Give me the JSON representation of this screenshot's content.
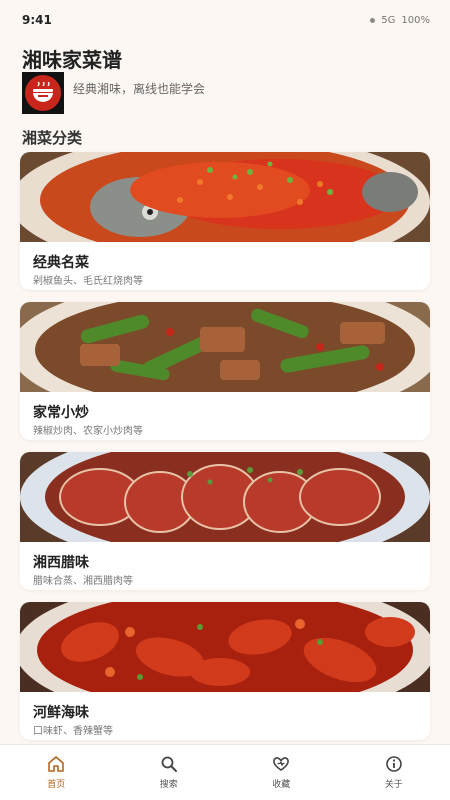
{
  "status": {
    "time": "9:41",
    "network": "5G",
    "battery": "100%"
  },
  "app": {
    "title": "湘味家菜谱",
    "subtitle": "经典湘味，离线也能学会"
  },
  "section": {
    "title": "湘菜分类"
  },
  "categories": [
    {
      "title": "经典名菜",
      "desc": "剁椒鱼头、毛氏红烧肉等"
    },
    {
      "title": "家常小炒",
      "desc": "辣椒炒肉、农家小炒肉等"
    },
    {
      "title": "湘西腊味",
      "desc": "腊味合蒸、湘西腊肉等"
    },
    {
      "title": "河鲜海味",
      "desc": "口味虾、香辣蟹等"
    }
  ],
  "tabs": [
    {
      "label": "首页",
      "icon": "home-icon",
      "active": true
    },
    {
      "label": "搜索",
      "icon": "search-icon",
      "active": false
    },
    {
      "label": "收藏",
      "icon": "heart-icon",
      "active": false
    },
    {
      "label": "关于",
      "icon": "info-icon",
      "active": false
    }
  ],
  "colors": {
    "accent": "#b5651d",
    "background": "#fcf7f2",
    "chili": "#c8261c"
  }
}
